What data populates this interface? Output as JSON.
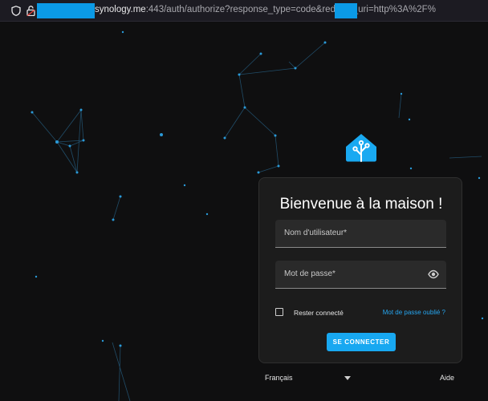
{
  "browser": {
    "url_host": "synology.me",
    "url_rest": ":443/auth/authorize?response_type=code&redirect_uri=http%3A%2F%",
    "icons": [
      "shield-icon",
      "lock-broken-icon"
    ],
    "redacted_color": "#0b9ae6"
  },
  "login": {
    "title": "Bienvenue à la maison !",
    "username_label": "Nom d'utilisateur*",
    "password_label": "Mot de passe*",
    "remember_label": "Rester connecté",
    "forgot_link": "Mot de passe oublié ?",
    "submit_label": "SE CONNECTER"
  },
  "footer": {
    "language": "Français",
    "help": "Aide"
  },
  "colors": {
    "accent": "#18a8f1",
    "background": "#0f0f10",
    "card": "#1c1c1c",
    "field": "#2a2a2a"
  }
}
